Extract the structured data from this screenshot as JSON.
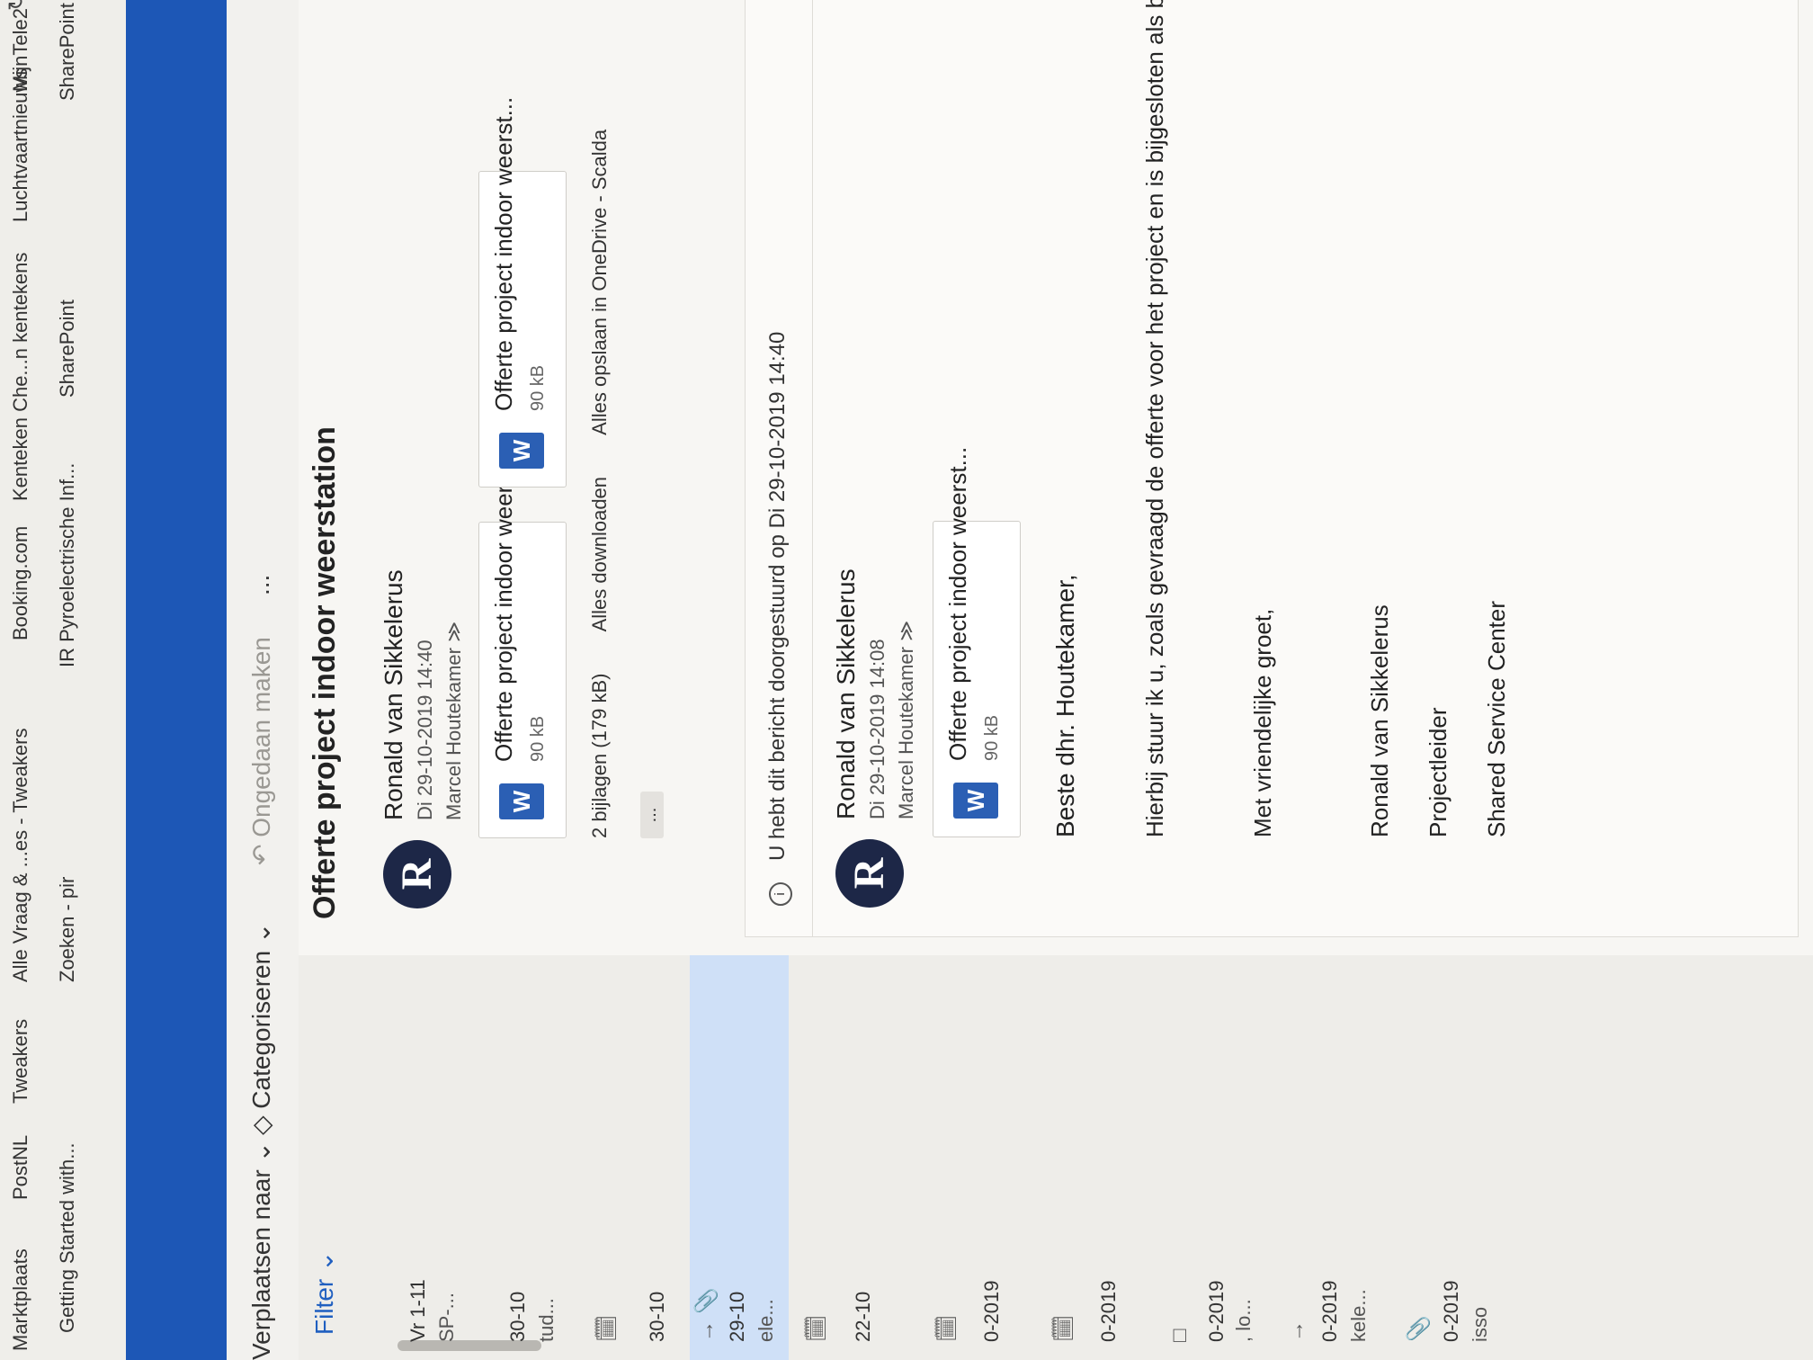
{
  "bookmarks": {
    "row1": [
      "Marktplaats",
      "PostNL",
      "Tweakers",
      "Alle Vraag & ...es - Tweakers",
      "Booking.com",
      "Kenteken Che...n kentekens",
      "Luchtvaartnieuws",
      "MijnTele2"
    ],
    "row2": [
      "Getting Started with...",
      "Zoeken - pir",
      "IR Pyroelectrische Inf...",
      "SharePoint",
      "SharePoint"
    ]
  },
  "toolbar": {
    "move_label": "Verplaatsen naar",
    "categorize_label": "Categoriseren",
    "undo_label": "Ongedaan maken",
    "more_label": "..."
  },
  "message_list": {
    "filter_label": "Filter",
    "items": [
      {
        "date": "Vr 1-11",
        "subtitle": "SP-..."
      },
      {
        "date": "30-10",
        "subtitle": "tud..."
      },
      {
        "date": "30-10",
        "subtitle": ""
      },
      {
        "date": "29-10",
        "subtitle": "ele..."
      },
      {
        "date": "22-10",
        "subtitle": ""
      },
      {
        "date": "0-2019",
        "subtitle": ""
      },
      {
        "date": "0-2019",
        "subtitle": ""
      },
      {
        "date": "0-2019",
        "subtitle": ", lo..."
      },
      {
        "date": "0-2019",
        "subtitle": "kele..."
      },
      {
        "date": "0-2019",
        "subtitle": "isso"
      }
    ]
  },
  "message": {
    "subject": "Offerte project indoor weerstation",
    "latest": {
      "avatar_letter": "R",
      "sender": "Ronald van Sikkelerus",
      "datetime": "Di 29-10-2019 14:40",
      "recipient": "Marcel Houtekamer ≫",
      "attachments": [
        {
          "name": "Offerte project indoor weerst...",
          "size": "90 kB"
        },
        {
          "name": "Offerte project indoor weerst...",
          "size": "90 kB"
        }
      ],
      "attachments_summary": "2 bijlagen (179 kB)",
      "download_all": "Alles downloaden",
      "save_all": "Alles opslaan in OneDrive - Scalda",
      "expand_label": "..."
    },
    "forward_notice": "U hebt dit bericht doorgestuurd op Di 29-10-2019 14:40",
    "original": {
      "avatar_letter": "R",
      "sender": "Ronald van Sikkelerus",
      "datetime": "Di 29-10-2019 14:08",
      "recipient": "Marcel Houtekamer ≫",
      "attachment": {
        "name": "Offerte project indoor weerst...",
        "size": "90 kB"
      },
      "body": {
        "greeting": "Beste dhr. Houtekamer,",
        "line1": "Hierbij stuur ik u, zoals gevraagd de offerte voor het project en is bijgesloten als bijlage.",
        "closing": "Met vriendelijke groet,",
        "name": "Ronald van Sikkelerus",
        "role": "Projectleider",
        "org": "Shared Service Center"
      }
    }
  }
}
